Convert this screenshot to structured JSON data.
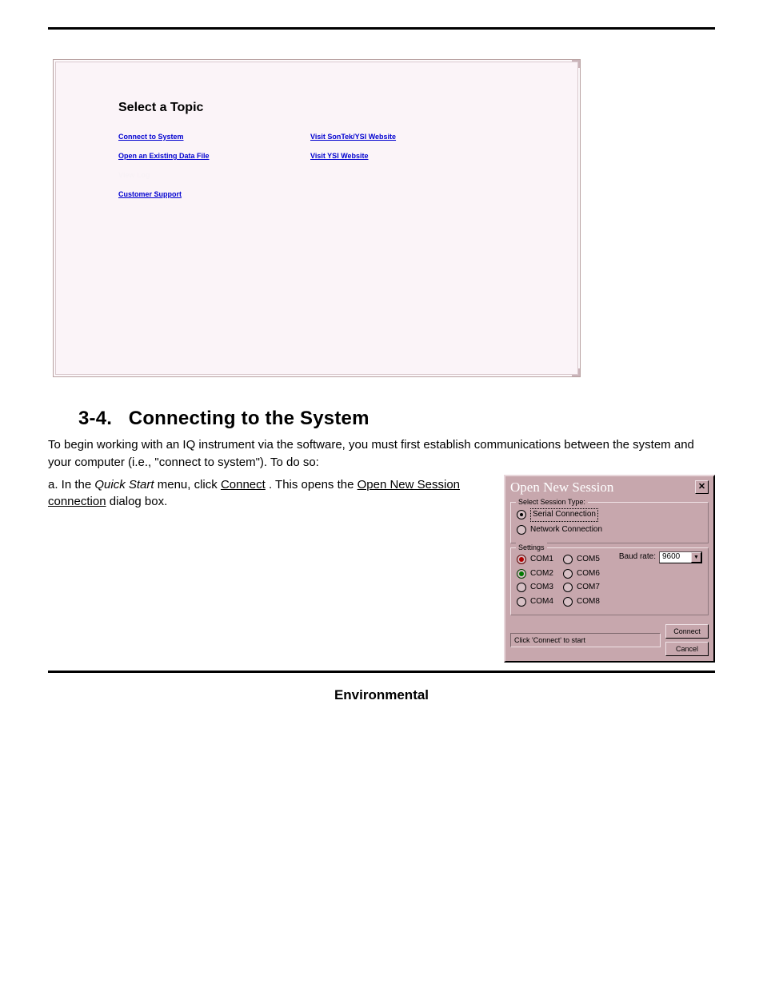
{
  "help": {
    "title": "Select a Topic",
    "left_links": [
      "Connect to System",
      "Open an Existing Data File",
      "View Log",
      "Customer Support"
    ],
    "right_links": [
      "Visit SonTek/YSI Website",
      "Visit YSI Website"
    ]
  },
  "section": {
    "number": "3-4.",
    "title": "Connecting to the System"
  },
  "para1": "To begin working with an IQ instrument via the software, you must first establish communications between the system and your computer (i.e., \"connect to system\"). To do so:",
  "step_a_prefix": "a. In the ",
  "step_a_italic": "Quick Start",
  "step_a_mid1": " menu, click ",
  "step_a_u1": "Connect",
  "step_a_mid2": ". This opens the ",
  "step_a_u2": "Open New Session connection",
  "step_a_mid3": " dialog box.",
  "dialog": {
    "title": "Open New Session",
    "session_legend": "Select Session Type:",
    "session_types": [
      {
        "label": "Serial Connection",
        "selected": true
      },
      {
        "label": "Network Connection",
        "selected": false
      }
    ],
    "settings_legend": "Settings",
    "com_ports_left": [
      {
        "label": "COM1",
        "variant": "red"
      },
      {
        "label": "COM2",
        "variant": "green",
        "selected": true
      },
      {
        "label": "COM3",
        "variant": "plain"
      },
      {
        "label": "COM4",
        "variant": "plain"
      }
    ],
    "com_ports_right": [
      {
        "label": "COM5"
      },
      {
        "label": "COM6"
      },
      {
        "label": "COM7"
      },
      {
        "label": "COM8"
      }
    ],
    "baud_label": "Baud rate:",
    "baud_value": "9600",
    "status": "Click 'Connect' to start",
    "connect": "Connect",
    "cancel": "Cancel"
  },
  "footer": "Environmental"
}
